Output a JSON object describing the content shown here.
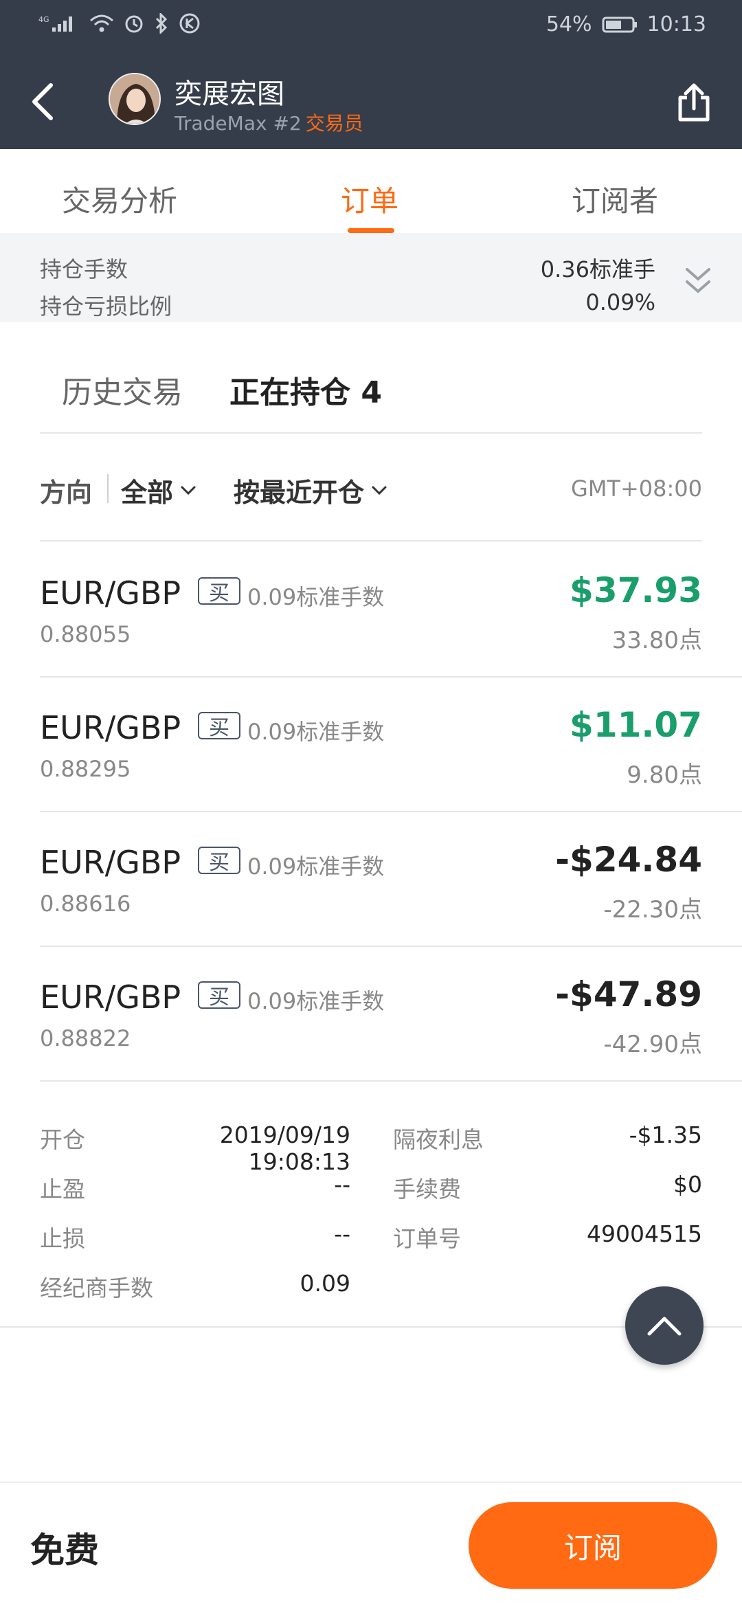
{
  "status_bar": {
    "signal_label": "4G",
    "battery_percent": "54%",
    "time": "10:13",
    "icons": [
      "signal-icon",
      "wifi-icon",
      "alarm-icon",
      "bluetooth-icon",
      "k-app-icon",
      "battery-icon"
    ]
  },
  "header": {
    "trader_name": "奕展宏图",
    "platform": "TradeMax #2",
    "role": "交易员",
    "back_icon": "chevron-left-icon",
    "share_icon": "share-icon"
  },
  "tabs": [
    {
      "label": "交易分析",
      "active": false
    },
    {
      "label": "订单",
      "active": true
    },
    {
      "label": "订阅者",
      "active": false
    }
  ],
  "summary": {
    "holding_lots_label": "持仓手数",
    "holding_lots_value": "0.36标准手",
    "loss_ratio_label": "持仓亏损比例",
    "loss_ratio_value": "0.09%"
  },
  "subtabs": {
    "history": "历史交易",
    "open_positions": "正在持仓 4"
  },
  "filter": {
    "direction_label": "方向",
    "direction_value": "全部",
    "sort_label": "按最近开仓",
    "timezone": "GMT+08:00"
  },
  "orders": [
    {
      "pair": "EUR/GBP",
      "side": "买",
      "lots": "0.09标准手数",
      "price": "0.88055",
      "profit": "$37.93",
      "points": "33.80点"
    },
    {
      "pair": "EUR/GBP",
      "side": "买",
      "lots": "0.09标准手数",
      "price": "0.88295",
      "profit": "$11.07",
      "points": "9.80点"
    },
    {
      "pair": "EUR/GBP",
      "side": "买",
      "lots": "0.09标准手数",
      "price": "0.88616",
      "profit": "-$24.84",
      "points": "-22.30点"
    },
    {
      "pair": "EUR/GBP",
      "side": "买",
      "lots": "0.09标准手数",
      "price": "0.88822",
      "profit": "-$47.89",
      "points": "-42.90点"
    }
  ],
  "details": {
    "open_label": "开仓",
    "open_value": "2019/09/19 19:08:13",
    "tp_label": "止盈",
    "tp_value": "--",
    "sl_label": "止损",
    "sl_value": "--",
    "broker_lots_label": "经纪商手数",
    "broker_lots_value": "0.09",
    "swap_label": "隔夜利息",
    "swap_value": "-$1.35",
    "fee_label": "手续费",
    "fee_value": "$0",
    "order_no_label": "订单号",
    "order_no_value": "49004515"
  },
  "bottom": {
    "price_label": "免费",
    "subscribe_label": "订阅"
  },
  "colors": {
    "header_bg": "#363d4a",
    "accent": "#ff6a13",
    "profit_green": "#1a9e6b"
  }
}
